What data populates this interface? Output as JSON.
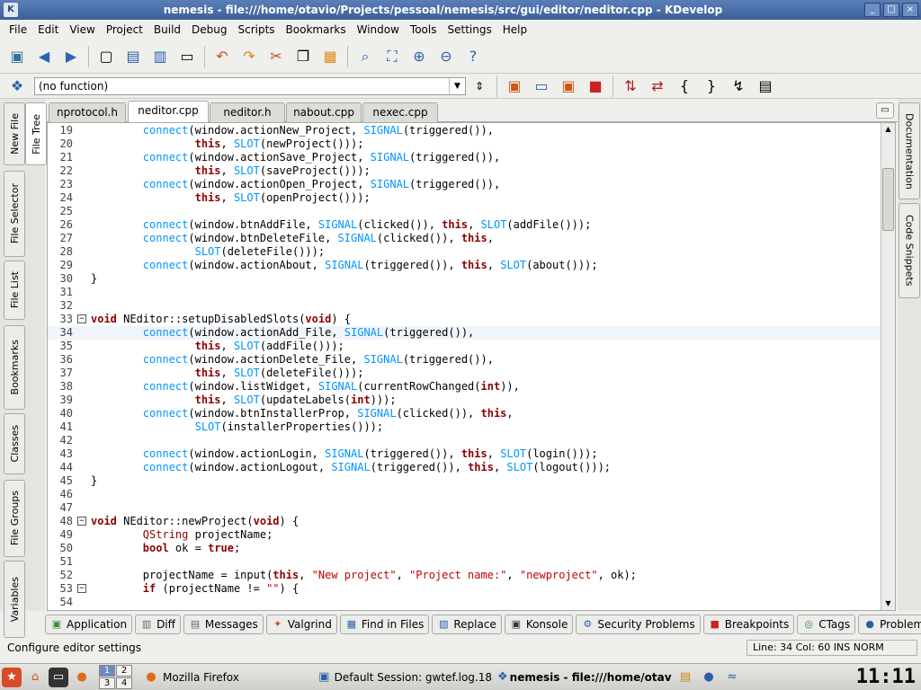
{
  "window": {
    "title": "nemesis - file:///home/otavio/Projects/pessoal/nemesis/src/gui/editor/neditor.cpp - KDevelop"
  },
  "menu": [
    "File",
    "Edit",
    "View",
    "Project",
    "Build",
    "Debug",
    "Scripts",
    "Bookmarks",
    "Window",
    "Tools",
    "Settings",
    "Help"
  ],
  "function_combo": {
    "value": "(no function)"
  },
  "left_tabs": [
    "New File",
    "File Tree",
    "File Selector",
    "File List",
    "Bookmarks",
    "Classes",
    "File Groups",
    "Variables"
  ],
  "right_tabs": [
    "Documentation",
    "Code Snippets"
  ],
  "file_tabs": [
    {
      "label": "nprotocol.h",
      "active": false
    },
    {
      "label": "neditor.cpp",
      "active": true
    },
    {
      "label": "neditor.h",
      "active": false
    },
    {
      "label": "nabout.cpp",
      "active": false
    },
    {
      "label": "nexec.cpp",
      "active": false
    }
  ],
  "code": [
    {
      "n": "19",
      "t": "        connect(window.actionNew_Project, SIGNAL(triggered()),"
    },
    {
      "n": "20",
      "t": "                this, SLOT(newProject()));"
    },
    {
      "n": "21",
      "t": "        connect(window.actionSave_Project, SIGNAL(triggered()),"
    },
    {
      "n": "22",
      "t": "                this, SLOT(saveProject()));"
    },
    {
      "n": "23",
      "t": "        connect(window.actionOpen_Project, SIGNAL(triggered()),"
    },
    {
      "n": "24",
      "t": "                this, SLOT(openProject()));"
    },
    {
      "n": "25",
      "t": ""
    },
    {
      "n": "26",
      "t": "        connect(window.btnAddFile, SIGNAL(clicked()), this, SLOT(addFile()));"
    },
    {
      "n": "27",
      "t": "        connect(window.btnDeleteFile, SIGNAL(clicked()), this,"
    },
    {
      "n": "28",
      "t": "                SLOT(deleteFile()));"
    },
    {
      "n": "29",
      "t": "        connect(window.actionAbout, SIGNAL(triggered()), this, SLOT(about()));"
    },
    {
      "n": "30",
      "t": "}"
    },
    {
      "n": "31",
      "t": ""
    },
    {
      "n": "32",
      "t": ""
    },
    {
      "n": "33",
      "t": "void NEditor::setupDisabledSlots(void) {",
      "fold": true
    },
    {
      "n": "34",
      "t": "        connect(window.actionAdd_File, SIGNAL(triggered()),",
      "cur": true
    },
    {
      "n": "35",
      "t": "                this, SLOT(addFile()));"
    },
    {
      "n": "36",
      "t": "        connect(window.actionDelete_File, SIGNAL(triggered()),"
    },
    {
      "n": "37",
      "t": "                this, SLOT(deleteFile()));"
    },
    {
      "n": "38",
      "t": "        connect(window.listWidget, SIGNAL(currentRowChanged(int)),"
    },
    {
      "n": "39",
      "t": "                this, SLOT(updateLabels(int)));"
    },
    {
      "n": "40",
      "t": "        connect(window.btnInstallerProp, SIGNAL(clicked()), this,"
    },
    {
      "n": "41",
      "t": "                SLOT(installerProperties()));"
    },
    {
      "n": "42",
      "t": ""
    },
    {
      "n": "43",
      "t": "        connect(window.actionLogin, SIGNAL(triggered()), this, SLOT(login()));"
    },
    {
      "n": "44",
      "t": "        connect(window.actionLogout, SIGNAL(triggered()), this, SLOT(logout()));"
    },
    {
      "n": "45",
      "t": "}"
    },
    {
      "n": "46",
      "t": ""
    },
    {
      "n": "47",
      "t": ""
    },
    {
      "n": "48",
      "t": "void NEditor::newProject(void) {",
      "fold": true
    },
    {
      "n": "49",
      "t": "        QString projectName;"
    },
    {
      "n": "50",
      "t": "        bool ok = true;"
    },
    {
      "n": "51",
      "t": ""
    },
    {
      "n": "52",
      "t": "        projectName = input(this, \"New project\", \"Project name:\", \"newproject\", ok);"
    },
    {
      "n": "53",
      "t": "        if (projectName != \"\") {",
      "fold": true
    },
    {
      "n": "54",
      "t": ""
    }
  ],
  "bottom_tabs": [
    {
      "label": "Application",
      "icon": "terminal-icon"
    },
    {
      "label": "Diff",
      "icon": "diff-icon"
    },
    {
      "label": "Messages",
      "icon": "messages-icon"
    },
    {
      "label": "Valgrind",
      "icon": "valgrind-icon"
    },
    {
      "label": "Find in Files",
      "icon": "find-icon"
    },
    {
      "label": "Replace",
      "icon": "replace-icon"
    },
    {
      "label": "Konsole",
      "icon": "konsole-icon"
    },
    {
      "label": "Security Problems",
      "icon": "security-icon"
    },
    {
      "label": "Breakpoints",
      "icon": "breakpoint-icon"
    },
    {
      "label": "CTags",
      "icon": "ctags-icon"
    },
    {
      "label": "Problems",
      "icon": "problems-icon"
    }
  ],
  "status": {
    "message": "Configure editor settings",
    "position": "Line: 34 Col: 60  INS  NORM"
  },
  "taskbar": {
    "pager": [
      "1",
      "2",
      "3",
      "4"
    ],
    "tasks": [
      "Mozilla Firefox",
      "Default Session: gwtef.log.18",
      "nemesis - file:///home/otavio"
    ],
    "clock": "11:11"
  },
  "colors": {
    "keyword": "#0057ae",
    "type": "#8b0000",
    "string": "#bf0303",
    "qt": "#0095ff"
  }
}
